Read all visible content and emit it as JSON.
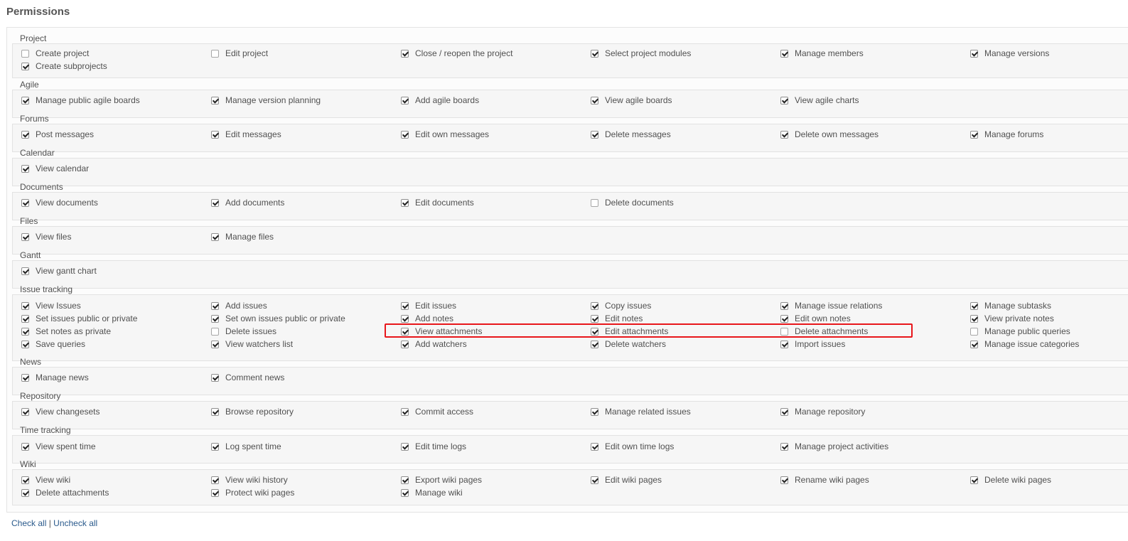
{
  "title": "Permissions",
  "sections": [
    {
      "name": "Project",
      "items": [
        {
          "label": "Create project",
          "checked": false
        },
        {
          "label": "Edit project",
          "checked": false
        },
        {
          "label": "Close / reopen the project",
          "checked": true
        },
        {
          "label": "Select project modules",
          "checked": true
        },
        {
          "label": "Manage members",
          "checked": true
        },
        {
          "label": "Manage versions",
          "checked": true
        },
        {
          "label": "Create subprojects",
          "checked": true
        }
      ]
    },
    {
      "name": "Agile",
      "items": [
        {
          "label": "Manage public agile boards",
          "checked": true
        },
        {
          "label": "Manage version planning",
          "checked": true
        },
        {
          "label": "Add agile boards",
          "checked": true
        },
        {
          "label": "View agile boards",
          "checked": true
        },
        {
          "label": "View agile charts",
          "checked": true
        }
      ]
    },
    {
      "name": "Forums",
      "items": [
        {
          "label": "Post messages",
          "checked": true
        },
        {
          "label": "Edit messages",
          "checked": true
        },
        {
          "label": "Edit own messages",
          "checked": true
        },
        {
          "label": "Delete messages",
          "checked": true
        },
        {
          "label": "Delete own messages",
          "checked": true
        },
        {
          "label": "Manage forums",
          "checked": true
        }
      ]
    },
    {
      "name": "Calendar",
      "items": [
        {
          "label": "View calendar",
          "checked": true
        }
      ]
    },
    {
      "name": "Documents",
      "items": [
        {
          "label": "View documents",
          "checked": true
        },
        {
          "label": "Add documents",
          "checked": true
        },
        {
          "label": "Edit documents",
          "checked": true
        },
        {
          "label": "Delete documents",
          "checked": false
        }
      ]
    },
    {
      "name": "Files",
      "items": [
        {
          "label": "View files",
          "checked": true
        },
        {
          "label": "Manage files",
          "checked": true
        }
      ]
    },
    {
      "name": "Gantt",
      "items": [
        {
          "label": "View gantt chart",
          "checked": true
        }
      ]
    },
    {
      "name": "Issue tracking",
      "items": [
        {
          "label": "View Issues",
          "checked": true
        },
        {
          "label": "Add issues",
          "checked": true
        },
        {
          "label": "Edit issues",
          "checked": true
        },
        {
          "label": "Copy issues",
          "checked": true
        },
        {
          "label": "Manage issue relations",
          "checked": true
        },
        {
          "label": "Manage subtasks",
          "checked": true
        },
        {
          "label": "Set issues public or private",
          "checked": true
        },
        {
          "label": "Set own issues public or private",
          "checked": true
        },
        {
          "label": "Add notes",
          "checked": true
        },
        {
          "label": "Edit notes",
          "checked": true
        },
        {
          "label": "Edit own notes",
          "checked": true
        },
        {
          "label": "View private notes",
          "checked": true
        },
        {
          "label": "Set notes as private",
          "checked": true
        },
        {
          "label": "Delete issues",
          "checked": false
        },
        {
          "label": "View attachments",
          "checked": true
        },
        {
          "label": "Edit attachments",
          "checked": true
        },
        {
          "label": "Delete attachments",
          "checked": false
        },
        {
          "label": "Manage public queries",
          "checked": false
        },
        {
          "label": "Save queries",
          "checked": true
        },
        {
          "label": "View watchers list",
          "checked": true
        },
        {
          "label": "Add watchers",
          "checked": true
        },
        {
          "label": "Delete watchers",
          "checked": true
        },
        {
          "label": "Import issues",
          "checked": true
        },
        {
          "label": "Manage issue categories",
          "checked": true
        }
      ]
    },
    {
      "name": "News",
      "items": [
        {
          "label": "Manage news",
          "checked": true
        },
        {
          "label": "Comment news",
          "checked": true
        }
      ]
    },
    {
      "name": "Repository",
      "items": [
        {
          "label": "View changesets",
          "checked": true
        },
        {
          "label": "Browse repository",
          "checked": true
        },
        {
          "label": "Commit access",
          "checked": true
        },
        {
          "label": "Manage related issues",
          "checked": true
        },
        {
          "label": "Manage repository",
          "checked": true
        }
      ]
    },
    {
      "name": "Time tracking",
      "items": [
        {
          "label": "View spent time",
          "checked": true
        },
        {
          "label": "Log spent time",
          "checked": true
        },
        {
          "label": "Edit time logs",
          "checked": true
        },
        {
          "label": "Edit own time logs",
          "checked": true
        },
        {
          "label": "Manage project activities",
          "checked": true
        }
      ]
    },
    {
      "name": "Wiki",
      "items": [
        {
          "label": "View wiki",
          "checked": true
        },
        {
          "label": "View wiki history",
          "checked": true
        },
        {
          "label": "Export wiki pages",
          "checked": true
        },
        {
          "label": "Edit wiki pages",
          "checked": true
        },
        {
          "label": "Rename wiki pages",
          "checked": true
        },
        {
          "label": "Delete wiki pages",
          "checked": true
        },
        {
          "label": "Delete attachments",
          "checked": true
        },
        {
          "label": "Protect wiki pages",
          "checked": true
        },
        {
          "label": "Manage wiki",
          "checked": true
        }
      ]
    }
  ],
  "footer": {
    "check_all": "Check all",
    "separator": "|",
    "uncheck_all": "Uncheck all"
  },
  "colors": {
    "highlight_border": "#e8161b",
    "link": "#2a5a8c"
  }
}
